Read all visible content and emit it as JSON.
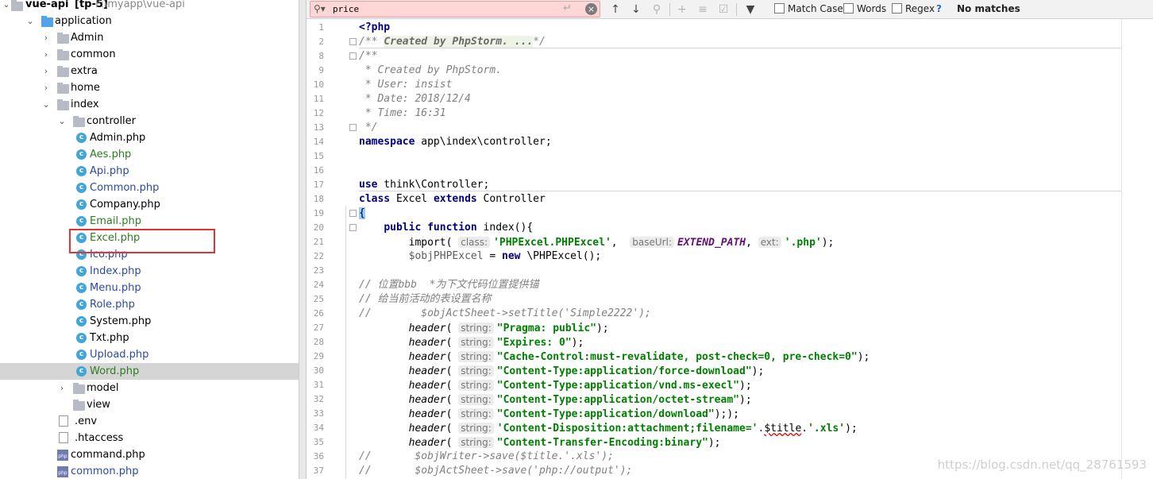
{
  "project": {
    "name": "vue-api",
    "module": "[tp-5]",
    "path": "F:\\myapp\\vue-api"
  },
  "tree": [
    {
      "label": "application",
      "kind": "folder-blue",
      "expanded": true,
      "depth": 1,
      "style": "normal"
    },
    {
      "label": "Admin",
      "kind": "folder",
      "expanded": false,
      "depth": 2,
      "style": "normal"
    },
    {
      "label": "common",
      "kind": "folder",
      "expanded": false,
      "depth": 2,
      "style": "normal"
    },
    {
      "label": "extra",
      "kind": "folder",
      "expanded": false,
      "depth": 2,
      "style": "normal"
    },
    {
      "label": "home",
      "kind": "folder",
      "expanded": false,
      "depth": 2,
      "style": "normal"
    },
    {
      "label": "index",
      "kind": "folder",
      "expanded": true,
      "depth": 2,
      "style": "normal"
    },
    {
      "label": "controller",
      "kind": "folder",
      "expanded": true,
      "depth": 3,
      "style": "normal"
    },
    {
      "label": "Admin.php",
      "kind": "class",
      "depth": 4,
      "style": "normal"
    },
    {
      "label": "Aes.php",
      "kind": "class",
      "depth": 4,
      "style": "green"
    },
    {
      "label": "Api.php",
      "kind": "class",
      "depth": 4,
      "style": "blue"
    },
    {
      "label": "Common.php",
      "kind": "class",
      "depth": 4,
      "style": "blue"
    },
    {
      "label": "Company.php",
      "kind": "class",
      "depth": 4,
      "style": "normal"
    },
    {
      "label": "Email.php",
      "kind": "class",
      "depth": 4,
      "style": "green"
    },
    {
      "label": "Excel.php",
      "kind": "class",
      "depth": 4,
      "style": "green"
    },
    {
      "label": "Ico.php",
      "kind": "class",
      "depth": 4,
      "style": "blue"
    },
    {
      "label": "Index.php",
      "kind": "class",
      "depth": 4,
      "style": "blue"
    },
    {
      "label": "Menu.php",
      "kind": "class",
      "depth": 4,
      "style": "blue"
    },
    {
      "label": "Role.php",
      "kind": "class",
      "depth": 4,
      "style": "blue"
    },
    {
      "label": "System.php",
      "kind": "class",
      "depth": 4,
      "style": "normal"
    },
    {
      "label": "Txt.php",
      "kind": "class",
      "depth": 4,
      "style": "normal"
    },
    {
      "label": "Upload.php",
      "kind": "class",
      "depth": 4,
      "style": "blue"
    },
    {
      "label": "Word.php",
      "kind": "class",
      "depth": 4,
      "style": "green",
      "selected": true
    },
    {
      "label": "model",
      "kind": "folder",
      "expanded": false,
      "depth": 3,
      "style": "normal"
    },
    {
      "label": "view",
      "kind": "folder",
      "depth": 3,
      "style": "normal"
    },
    {
      "label": ".env",
      "kind": "file",
      "depth": 2,
      "style": "normal"
    },
    {
      "label": ".htaccess",
      "kind": "file",
      "depth": 2,
      "style": "normal"
    },
    {
      "label": "command.php",
      "kind": "php",
      "depth": 2,
      "style": "normal"
    },
    {
      "label": "common.php",
      "kind": "php",
      "depth": 2,
      "style": "blue"
    }
  ],
  "find": {
    "query": "price",
    "match_case": "Match Case",
    "words": "Words",
    "regex": "Regex",
    "help": "?",
    "status": "No matches"
  },
  "code": [
    {
      "n": "1",
      "t": [
        [
          "kw",
          "<?php"
        ]
      ]
    },
    {
      "n": "2",
      "t": [
        [
          "cm",
          "/** "
        ],
        [
          "cmb",
          "Created by PhpStorm. ..."
        ],
        [
          "cm",
          "*/"
        ]
      ]
    },
    {
      "n": "8",
      "t": [
        [
          "cm",
          "/**"
        ]
      ]
    },
    {
      "n": "9",
      "t": [
        [
          "cm",
          " * Created by PhpStorm."
        ]
      ]
    },
    {
      "n": "10",
      "t": [
        [
          "cm",
          " * User: insist"
        ]
      ]
    },
    {
      "n": "11",
      "t": [
        [
          "cm",
          " * Date: 2018/12/4"
        ]
      ]
    },
    {
      "n": "12",
      "t": [
        [
          "cm",
          " * Time: 16:31"
        ]
      ]
    },
    {
      "n": "13",
      "t": [
        [
          "cm",
          " */"
        ]
      ]
    },
    {
      "n": "14",
      "t": [
        [
          "kw",
          "namespace"
        ],
        [
          "p",
          " app\\index\\controller;"
        ]
      ]
    },
    {
      "n": "15",
      "t": []
    },
    {
      "n": "16",
      "t": []
    },
    {
      "n": "17",
      "t": [
        [
          "kw",
          "use"
        ],
        [
          "p",
          " think\\Controller;"
        ]
      ]
    },
    {
      "n": "18",
      "t": [
        [
          "kw",
          "class"
        ],
        [
          "p",
          " Excel "
        ],
        [
          "kw",
          "extends"
        ],
        [
          "p",
          " Controller"
        ]
      ]
    },
    {
      "n": "19",
      "t": [
        [
          "brk",
          "{"
        ]
      ]
    },
    {
      "n": "20",
      "t": [
        [
          "p",
          "    "
        ],
        [
          "kw",
          "public function"
        ],
        [
          "p",
          " index(){"
        ]
      ]
    },
    {
      "n": "21",
      "t": [
        [
          "p",
          "        import( "
        ],
        [
          "hint",
          "class:"
        ],
        [
          "str",
          "'PHPExcel.PHPExcel'"
        ],
        [
          "p",
          ",  "
        ],
        [
          "hint",
          "baseUrl:"
        ],
        [
          "cst",
          "EXTEND_PATH"
        ],
        [
          "p",
          ", "
        ],
        [
          "hint",
          "ext:"
        ],
        [
          "str",
          "'.php'"
        ],
        [
          "p",
          ");"
        ]
      ]
    },
    {
      "n": "22",
      "t": [
        [
          "p",
          "        "
        ],
        [
          "vr",
          "$objPHPExcel"
        ],
        [
          "p",
          " = "
        ],
        [
          "kw",
          "new"
        ],
        [
          "p",
          " \\PHPExcel();"
        ]
      ]
    },
    {
      "n": "23",
      "t": []
    },
    {
      "n": "24",
      "t": [
        [
          "cm",
          "// 位置bbb  *为下文代码位置提供锚"
        ]
      ]
    },
    {
      "n": "25",
      "t": [
        [
          "cm",
          "// 给当前活动的表设置名称"
        ]
      ]
    },
    {
      "n": "26",
      "t": [
        [
          "cm",
          "//        $objActSheet->setTitle('Simple2222');"
        ]
      ]
    },
    {
      "n": "27",
      "t": [
        [
          "p",
          "        "
        ],
        [
          "fn",
          "header"
        ],
        [
          "p",
          "( "
        ],
        [
          "hint",
          "string:"
        ],
        [
          "str",
          "\"Pragma: public\""
        ],
        [
          "p",
          ");"
        ]
      ]
    },
    {
      "n": "28",
      "t": [
        [
          "p",
          "        "
        ],
        [
          "fn",
          "header"
        ],
        [
          "p",
          "( "
        ],
        [
          "hint",
          "string:"
        ],
        [
          "str",
          "\"Expires: 0\""
        ],
        [
          "p",
          ");"
        ]
      ]
    },
    {
      "n": "29",
      "t": [
        [
          "p",
          "        "
        ],
        [
          "fn",
          "header"
        ],
        [
          "p",
          "( "
        ],
        [
          "hint",
          "string:"
        ],
        [
          "str",
          "\"Cache-Control:must-revalidate, post-check=0, pre-check=0\""
        ],
        [
          "p",
          ");"
        ]
      ]
    },
    {
      "n": "30",
      "t": [
        [
          "p",
          "        "
        ],
        [
          "fn",
          "header"
        ],
        [
          "p",
          "( "
        ],
        [
          "hint",
          "string:"
        ],
        [
          "str",
          "\"Content-Type:application/force-download\""
        ],
        [
          "p",
          ");"
        ]
      ]
    },
    {
      "n": "31",
      "t": [
        [
          "p",
          "        "
        ],
        [
          "fn",
          "header"
        ],
        [
          "p",
          "( "
        ],
        [
          "hint",
          "string:"
        ],
        [
          "str",
          "\"Content-Type:application/vnd.ms-execl\""
        ],
        [
          "p",
          ");"
        ]
      ]
    },
    {
      "n": "32",
      "t": [
        [
          "p",
          "        "
        ],
        [
          "fn",
          "header"
        ],
        [
          "p",
          "( "
        ],
        [
          "hint",
          "string:"
        ],
        [
          "str",
          "\"Content-Type:application/octet-stream\""
        ],
        [
          "p",
          ");"
        ]
      ]
    },
    {
      "n": "33",
      "t": [
        [
          "p",
          "        "
        ],
        [
          "fn",
          "header"
        ],
        [
          "p",
          "( "
        ],
        [
          "hint",
          "string:"
        ],
        [
          "str",
          "\"Content-Type:application/download\""
        ],
        [
          "p",
          "););"
        ]
      ]
    },
    {
      "n": "34",
      "t": [
        [
          "p",
          "        "
        ],
        [
          "fn",
          "header"
        ],
        [
          "p",
          "( "
        ],
        [
          "hint",
          "string:"
        ],
        [
          "str",
          "'Content-Disposition:attachment;filename='"
        ],
        [
          "p",
          "."
        ],
        [
          "warn",
          "$title"
        ],
        [
          "p",
          "."
        ],
        [
          "str",
          "'.xls'"
        ],
        [
          "p",
          ");"
        ]
      ]
    },
    {
      "n": "35",
      "t": [
        [
          "p",
          "        "
        ],
        [
          "fn",
          "header"
        ],
        [
          "p",
          "( "
        ],
        [
          "hint",
          "string:"
        ],
        [
          "str",
          "\"Content-Transfer-Encoding:binary\""
        ],
        [
          "p",
          ");"
        ]
      ]
    },
    {
      "n": "36",
      "t": [
        [
          "cm",
          "//       $objWriter->save($title.'.xls');"
        ]
      ]
    },
    {
      "n": "37",
      "t": [
        [
          "cm",
          "//       $objActSheet->save('php://output');"
        ]
      ]
    }
  ],
  "watermark": "https://blog.csdn.net/qq_28761593"
}
